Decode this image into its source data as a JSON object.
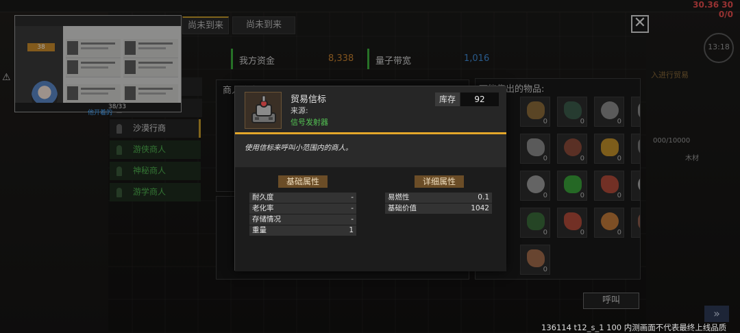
{
  "top_tabs": [
    {
      "label": "尚未到来"
    },
    {
      "label": "尚未到来"
    }
  ],
  "resources": {
    "funds": {
      "label": "我方资金",
      "value": "8,338"
    },
    "bandwidth": {
      "label": "量子带宽",
      "value": "1,016"
    }
  },
  "merchants": [
    {
      "label": "沙漠行商",
      "style": "normal"
    },
    {
      "label": "游侠商人",
      "style": "green"
    },
    {
      "label": "神秘商人",
      "style": "green"
    },
    {
      "label": "游学商人",
      "style": "green"
    }
  ],
  "merchant_panel": {
    "title": "商人信息:"
  },
  "sell_panel": {
    "title": "可能售出的物品:",
    "slot_quantity": "0",
    "slots": [
      {
        "icon": "hide-icon",
        "color": "#8a6a3a"
      },
      {
        "icon": "ore-dark-icon",
        "color": "#3b5b4b"
      },
      {
        "icon": "stone-pile-icon",
        "color": "#8a8a8a"
      },
      {
        "icon": "bar-icon",
        "color": "#8a8a8a"
      },
      {
        "icon": "stone-block-icon",
        "color": "#8a8a8a"
      },
      {
        "icon": "copper-ore-icon",
        "color": "#8a4a3a"
      },
      {
        "icon": "gold-ore-icon",
        "color": "#c0902a"
      },
      {
        "icon": "metal-icon",
        "color": "#7a7a7a"
      },
      {
        "icon": "ingot-icon",
        "color": "#9a9a9a"
      },
      {
        "icon": "herb-icon",
        "color": "#3aa03a"
      },
      {
        "icon": "starfish-icon",
        "color": "#b04a3a"
      },
      {
        "icon": "wolf-icon",
        "color": "#aaaaaa"
      },
      {
        "icon": "moss-icon",
        "color": "#3a6a3a"
      },
      {
        "icon": "spiky-icon",
        "color": "#b04a3a"
      },
      {
        "icon": "fox-icon",
        "color": "#c07a3a"
      },
      {
        "icon": "mushroom-icon",
        "color": "#8a5a4a"
      },
      {
        "icon": "cookie-icon",
        "color": "#a06a4a"
      }
    ]
  },
  "call_button": "呼叫",
  "popup": {
    "item_name": "贸易信标",
    "source_label": "来源:",
    "source_value": "信号发射器",
    "stock_label": "库存",
    "stock_value": "92",
    "description": "使用信标来呼叫小范围内的商人。",
    "basic_title": "基础属性",
    "detail_title": "详细属性",
    "basic_props": [
      {
        "k": "耐久度",
        "v": "-"
      },
      {
        "k": "老化率",
        "v": "-"
      },
      {
        "k": "存储情况",
        "v": "-"
      },
      {
        "k": "重量",
        "v": "1"
      }
    ],
    "detail_props": [
      {
        "k": "易燃性",
        "v": "0.1"
      },
      {
        "k": "基础价值",
        "v": "1042"
      }
    ]
  },
  "hud": {
    "timer": "30.36 30 0/0",
    "clock": "13:18",
    "side_text_1": "入进行贸易",
    "side_text_2": "000/10000",
    "side_text_3": "木材",
    "version": "136114 t12_s_1 100  内测画面不代表最终上线品质"
  },
  "mini_panel": {
    "score": "38",
    "link_text": "他开着的",
    "count": "38/33"
  },
  "colors": {
    "gold_accent": "#e4a72a",
    "funds_value": "#c8812e",
    "bandwidth_value": "#3f8bd6",
    "green_text": "#54c454",
    "timer_red": "#e84d4d"
  }
}
